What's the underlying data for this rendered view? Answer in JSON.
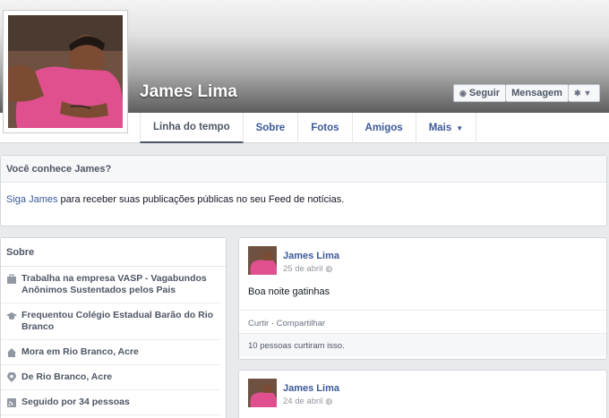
{
  "profile": {
    "name": "James Lima",
    "actions": {
      "follow": "Seguir",
      "message": "Mensagem"
    }
  },
  "tabs": [
    {
      "label": "Linha do tempo",
      "active": true
    },
    {
      "label": "Sobre"
    },
    {
      "label": "Fotos"
    },
    {
      "label": "Amigos"
    },
    {
      "label": "Mais"
    }
  ],
  "know_box": {
    "title": "Você conhece James?",
    "link": "Siga James",
    "text": " para receber suas publicações públicas no seu Feed de notícias."
  },
  "about": {
    "title": "Sobre",
    "items": [
      {
        "icon": "briefcase-icon",
        "text": "Trabalha na empresa VASP - Vagabundos Anônimos Sustentados pelos Pais"
      },
      {
        "icon": "graduation-cap-icon",
        "text": "Frequentou Colégio Estadual Barão do Rio Branco"
      },
      {
        "icon": "house-icon",
        "text": "Mora em Rio Branco, Acre"
      },
      {
        "icon": "location-pin-icon",
        "text": "De Rio Branco, Acre"
      },
      {
        "icon": "feed-icon",
        "text": "Seguido por 34 pessoas"
      }
    ]
  },
  "posts": [
    {
      "author": "James Lima",
      "date": "25 de abril",
      "text": "Boa noite gatinhas",
      "actions": "Curtir · Compartilhar",
      "likes": "10 pessoas curtiram isso."
    },
    {
      "author": "James Lima",
      "date": "24 de abril"
    }
  ]
}
